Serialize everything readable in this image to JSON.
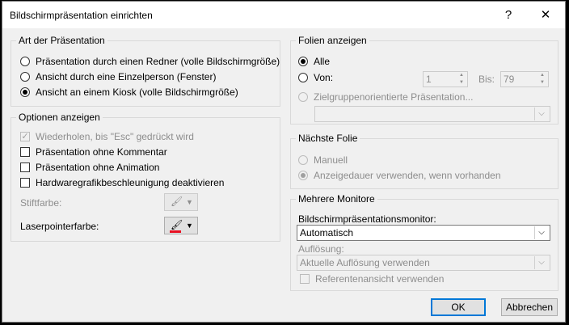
{
  "window": {
    "title": "Bildschirmpräsentation einrichten",
    "help_label": "?",
    "close_label": "✕"
  },
  "art": {
    "title": "Art der Präsentation",
    "options": [
      {
        "label": "Präsentation durch einen Redner (volle Bildschirmgröße)",
        "checked": false
      },
      {
        "label": "Ansicht durch eine Einzelperson (Fenster)",
        "checked": false
      },
      {
        "label": "Ansicht an einem Kiosk (volle Bildschirmgröße)",
        "checked": true
      }
    ]
  },
  "optionen": {
    "title": "Optionen anzeigen",
    "checks": [
      {
        "label": "Wiederholen, bis \"Esc\" gedrückt wird",
        "checked": true,
        "disabled": true
      },
      {
        "label": "Präsentation ohne Kommentar",
        "checked": false,
        "disabled": false
      },
      {
        "label": "Präsentation ohne Animation",
        "checked": false,
        "disabled": false
      },
      {
        "label": "Hardwaregrafikbeschleunigung deaktivieren",
        "checked": false,
        "disabled": false
      }
    ],
    "stiftfarbe_label": "Stiftfarbe:",
    "laserpointer_label": "Laserpointerfarbe:",
    "laserpointer_color": "#e81123"
  },
  "folien": {
    "title": "Folien anzeigen",
    "alle_label": "Alle",
    "von_label": "Von:",
    "von_value": "1",
    "bis_label": "Bis:",
    "bis_value": "79",
    "zielgruppe_label": "Zielgruppenorientierte Präsentation...",
    "zielgruppe_value": ""
  },
  "naechste": {
    "title": "Nächste Folie",
    "manuell_label": "Manuell",
    "anzeigedauer_label": "Anzeigedauer verwenden, wenn vorhanden"
  },
  "monitore": {
    "title": "Mehrere Monitore",
    "monitor_label": "Bildschirmpräsentationsmonitor:",
    "monitor_value": "Automatisch",
    "aufloesung_label": "Auflösung:",
    "aufloesung_value": "Aktuelle Auflösung verwenden",
    "referenten_label": "Referentenansicht verwenden"
  },
  "footer": {
    "ok_label": "OK",
    "cancel_label": "Abbrechen"
  },
  "colors": {
    "accent": "#0078d7",
    "dialog_bg": "#f0f0f0",
    "disabled_text": "#8d8d8d"
  }
}
